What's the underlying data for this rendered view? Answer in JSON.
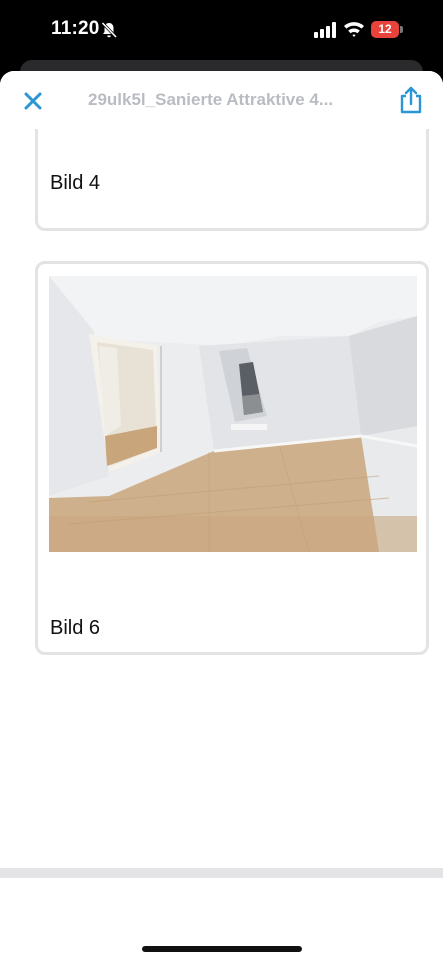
{
  "status_bar": {
    "time": "11:20",
    "battery_level": "12",
    "battery_color": "#e8433a",
    "icons": [
      "bell-slash-icon",
      "cellular-signal-icon",
      "wifi-icon",
      "battery-icon"
    ]
  },
  "header": {
    "title": "29ulk5l_Sanierte Attraktive 4...",
    "close_icon": "close-icon",
    "share_icon": "share-icon",
    "accent_color": "#2a96d6"
  },
  "images": [
    {
      "caption": "Bild 4"
    },
    {
      "caption": "Bild 6"
    }
  ]
}
